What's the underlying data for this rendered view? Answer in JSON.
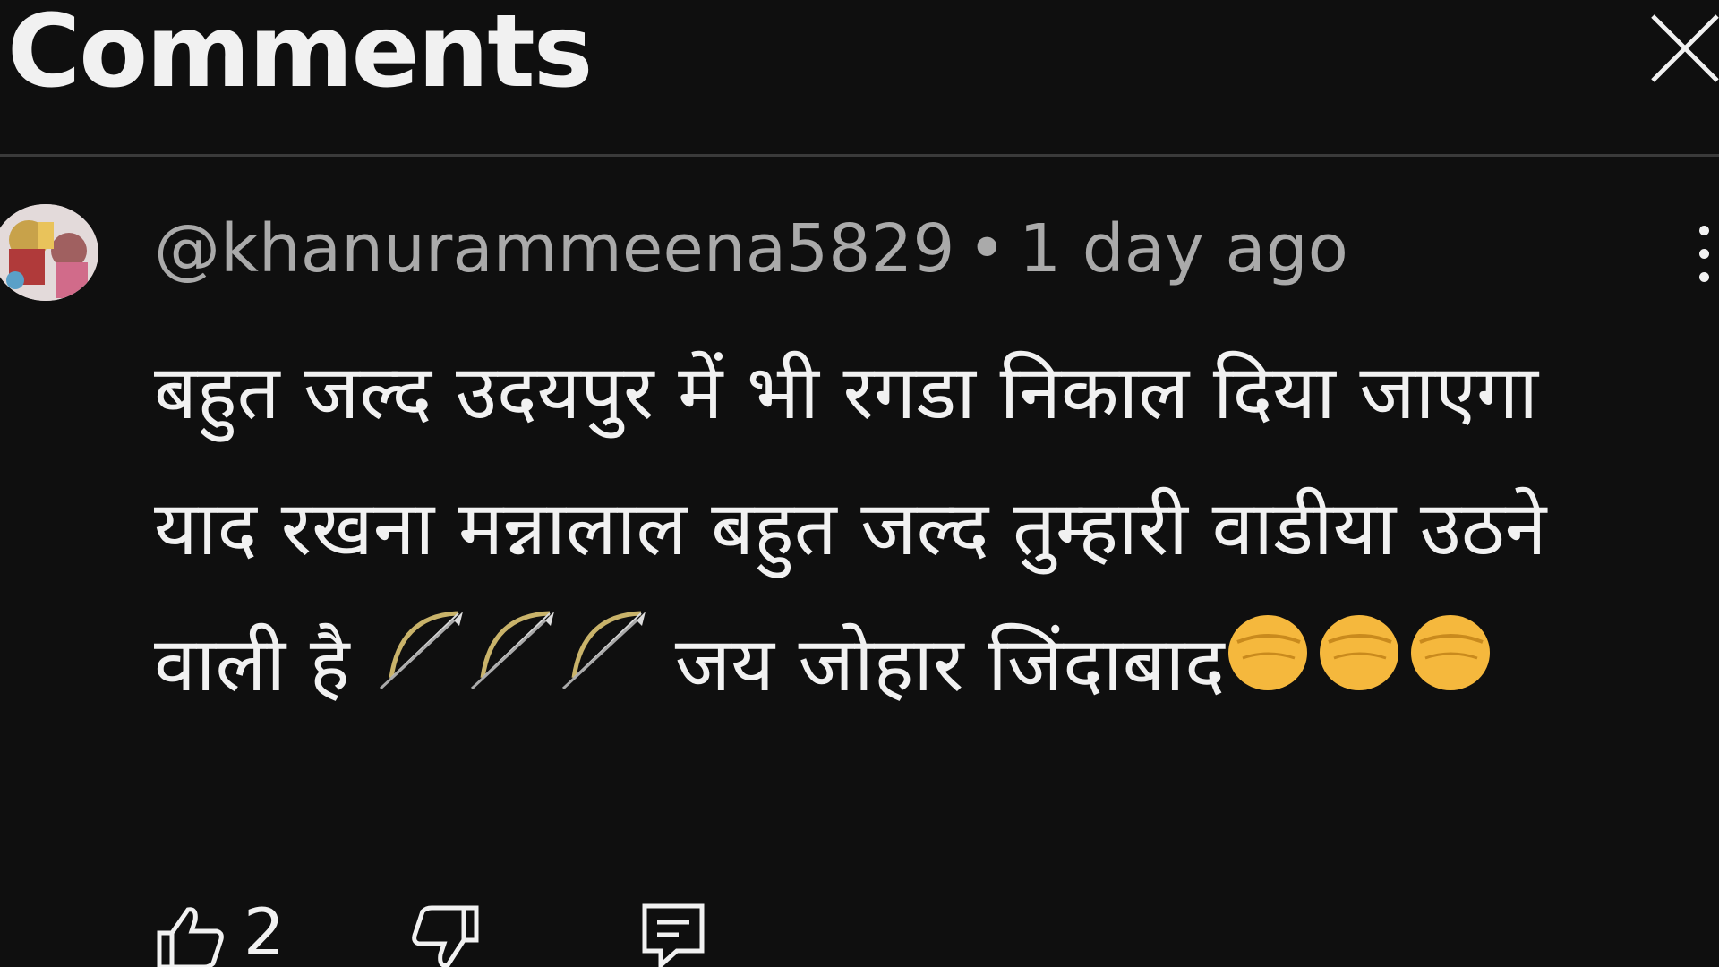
{
  "header": {
    "title": "Comments"
  },
  "comment": {
    "author": "@khanurammeena5829",
    "separator": "•",
    "timestamp": "1 day ago",
    "text_part1": "बहुत जल्द उदयपुर में भी रगडा निकाल दिया जाएगा  याद रखना मन्नालाल बहुत जल्द तुम्हारी वाडीया उठने वाली है ",
    "text_part2": " जय जोहार जिंदाबाद",
    "inline_emojis_1": [
      "bow-and-arrow",
      "bow-and-arrow",
      "bow-and-arrow"
    ],
    "inline_emojis_2": [
      "raised-fist",
      "raised-fist",
      "raised-fist"
    ],
    "likes": "2"
  },
  "icons": {
    "close": "close-icon",
    "more": "kebab-menu-icon",
    "like": "thumbs-up-icon",
    "dislike": "thumbs-down-icon",
    "reply": "reply-icon"
  },
  "colors": {
    "background": "#0f0f0f",
    "text": "#f1f1f1",
    "meta": "#aaaaaa",
    "divider": "#3a3a3a"
  }
}
